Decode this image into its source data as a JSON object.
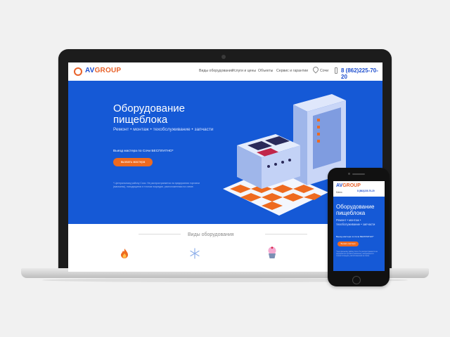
{
  "site": {
    "logo": {
      "prefix": "AV",
      "suffix": "GROUP"
    },
    "nav": [
      "Виды оборудования",
      "Услуги и цены",
      "Объекты",
      "Сервис и гарантии"
    ],
    "city": "Сочи",
    "phone": "8 (862)225-70-20"
  },
  "hero": {
    "title_line1": "Оборудование",
    "title_line2": "пищеблока",
    "subtitle": "Ремонт • монтаж • техобслуживание • запчасти",
    "cta_label": "Выезд мастера по Сочи БЕСПЛАТНО*",
    "cta_button": "вызвать мастера",
    "footnote": "* Центральному району Сочи. Не распространяется на предприятия торговли (магазины), находящиеся в точном посредии, расположенным на схеме."
  },
  "section": {
    "title": "Виды оборудования"
  },
  "mobile": {
    "logo": {
      "prefix": "AV",
      "suffix": "GROUP"
    },
    "menu": "Меню",
    "phone": "8 (862)225-70-20",
    "title_line1": "Оборудование",
    "title_line2": "пищеблока",
    "subtitle": "Ремонт • монтаж • техобслуживание • запчасти",
    "cta_label": "Выезд мастера по Сочи БЕСПЛАТНО*",
    "cta_button": "Вызвать мастера"
  },
  "colors": {
    "brand_blue": "#1559d6",
    "accent_orange": "#ee6a1f",
    "logo_blue": "#1e4fcf"
  },
  "icons": [
    "fire-icon",
    "snowflake-icon",
    "cupcake-icon",
    "location-pin-icon",
    "phone-icon"
  ]
}
